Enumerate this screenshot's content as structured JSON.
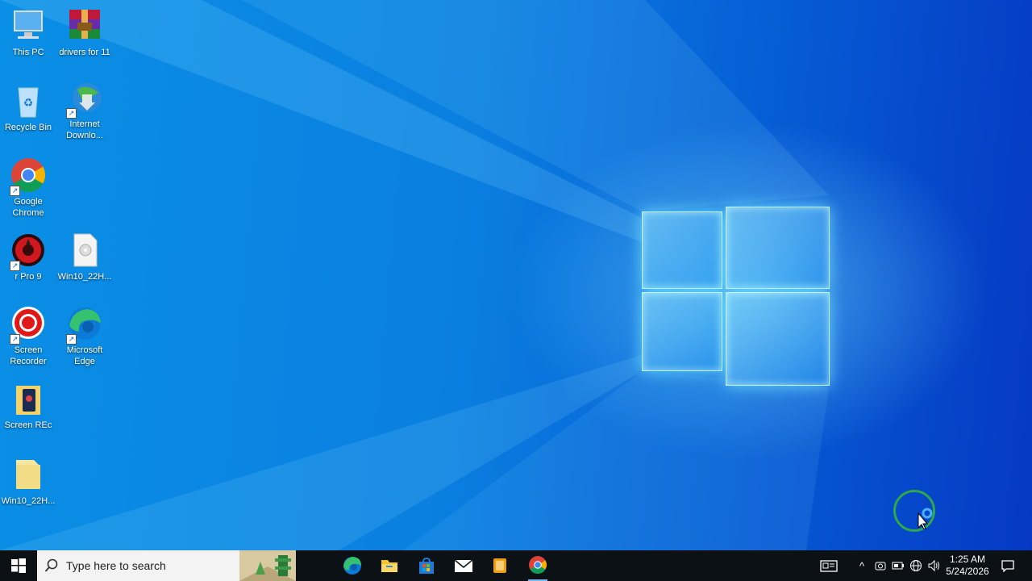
{
  "desktop": {
    "icons": [
      {
        "label": "This PC",
        "icon": "computer-icon"
      },
      {
        "label": "drivers for 11",
        "icon": "winrar-archive-icon"
      },
      {
        "label": "Recycle Bin",
        "icon": "recycle-bin-icon"
      },
      {
        "label": "Internet Downlo...",
        "icon": "internet-download-manager-icon"
      },
      {
        "label": "Google Chrome",
        "icon": "chrome-icon"
      },
      {
        "label": "r Pro 9",
        "icon": "red-app-icon"
      },
      {
        "label": "Win10_22H...",
        "icon": "disc-image-file-icon"
      },
      {
        "label": "Screen Recorder",
        "icon": "screen-recorder-icon"
      },
      {
        "label": "Microsoft Edge",
        "icon": "edge-icon"
      },
      {
        "label": "Screen REc",
        "icon": "folder-icon"
      },
      {
        "label": "Win10_22H...",
        "icon": "folder-icon"
      }
    ]
  },
  "taskbar": {
    "search_placeholder": "Type here to search",
    "pinned": [
      "task-view-icon",
      "edge-icon",
      "file-explorer-icon",
      "microsoft-store-icon",
      "mail-icon",
      "media-app-icon",
      "chrome-icon"
    ],
    "clock": {
      "time": "1:25 AM",
      "date": "5/24/2026"
    }
  },
  "colors": {
    "taskbar": "#0c1116",
    "desktop_accent": "#0a8fe6",
    "cursor_ring": "#2da84b"
  }
}
